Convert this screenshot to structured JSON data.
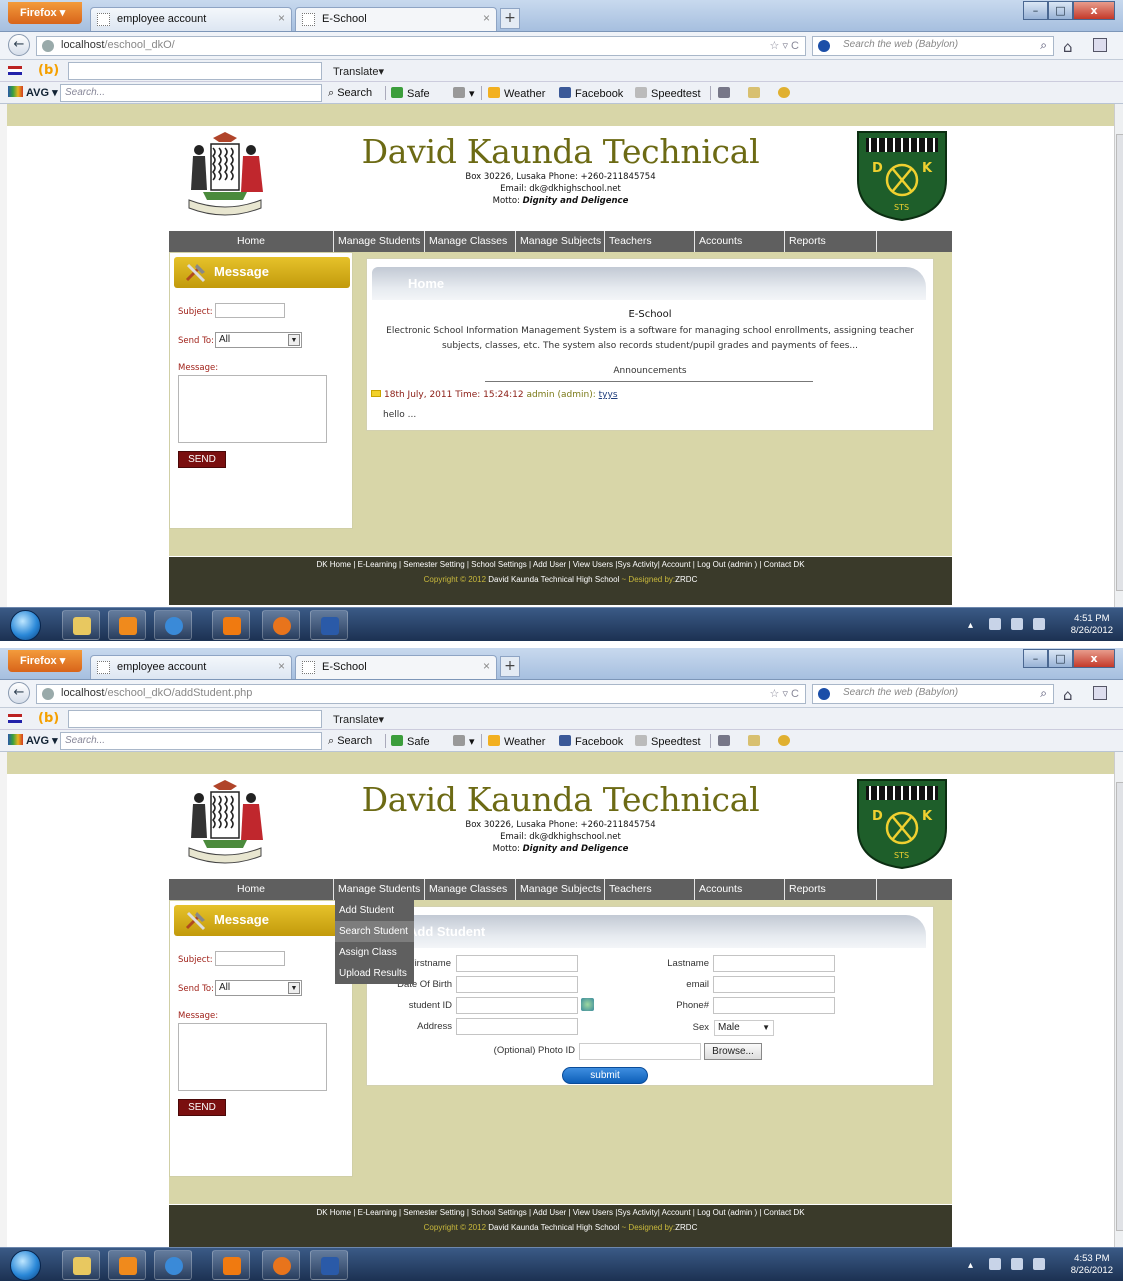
{
  "browser": {
    "firefox_label": "Firefox",
    "tab1_title": "employee account",
    "tab2_title": "E-School",
    "newtab_symbol": "+",
    "search_placeholder": "Search the web (Babylon)",
    "translate_label": "Translate▾",
    "avg_label": "AVG ▾",
    "avg_search_placeholder": "Search...",
    "toolbar": {
      "search": "Search",
      "safe": "Safe",
      "weather": "Weather",
      "facebook": "Facebook",
      "speedtest": "Speedtest"
    }
  },
  "screens": [
    {
      "url_host": "localhost",
      "url_path": "/eschool_dkO/",
      "clock_time": "4:51 PM",
      "clock_date": "8/26/2012"
    },
    {
      "url_host": "localhost",
      "url_path": "/eschool_dkO/addStudent.php",
      "clock_time": "4:53 PM",
      "clock_date": "8/26/2012"
    }
  ],
  "site": {
    "title": "David Kaunda Technical",
    "address_line": "Box 30226, Lusaka Phone: +260-211845754",
    "email_line": "Email: dk@dkhighschool.net",
    "motto_prefix": "Motto: ",
    "motto": "Dignity and Deligence",
    "crest_letter_left": "D",
    "crest_letter_right": "K",
    "crest_letters_bottom": "STS"
  },
  "menu": {
    "home": "Home",
    "manage_students": "Manage Students",
    "manage_classes": "Manage Classes",
    "manage_subjects": "Manage Subjects",
    "teachers": "Teachers",
    "accounts": "Accounts",
    "reports": "Reports"
  },
  "dropdown": {
    "add_student": "Add Student",
    "search_student": "Search Student",
    "assign_class": "Assign Class",
    "upload_results": "Upload Results"
  },
  "sidebar": {
    "header": "Message",
    "subject_label": "Subject:",
    "sendto_label": "Send To:",
    "sendto_value": "All",
    "message_label": "Message:",
    "send_button": "SEND"
  },
  "home_panel": {
    "title": "Home",
    "eschool_title": "E-School",
    "description": "Electronic School Information Management System is a software for managing school enrollments, assigning teacher subjects, classes, etc. The system also records student/pupil grades and payments of fees...",
    "announcements_title": "Announcements",
    "announcement": {
      "date": "18th July, 2011 Time: 15:24:12",
      "author": "admin (admin):",
      "subject": "tyys",
      "body": "hello ..."
    }
  },
  "add_student_panel": {
    "title": "Add Student",
    "firstname_label": "Firstname",
    "lastname_label": "Lastname",
    "dob_label": "Date Of Birth",
    "email_label": "email",
    "student_id_label": "student ID",
    "phone_label": "Phone#",
    "address_label": "Address",
    "sex_label": "Sex",
    "sex_value": "Male",
    "photo_label": "(Optional) Photo ID",
    "browse_button": "Browse...",
    "submit_button": "submit"
  },
  "footer": {
    "links": "DK Home | E-Learning | Semester Setting | School Settings | Add User | View Users |Sys Activity| Account | Log Out (admin ) | Contact DK",
    "copyright_prefix": "Copyright © 2012 ",
    "school_name": "David Kaunda Technical High School",
    "designed_by": " ~ Designed by:",
    "designer": "ZRDC"
  },
  "colors": {
    "page_bg": "#d8d6a8",
    "title_olive": "#6c6a14",
    "menu_gray": "#5f5f5f",
    "message_gold": "#d4ae1a",
    "send_red": "#7a0f0f",
    "footer_dark": "#3a3a2a"
  }
}
